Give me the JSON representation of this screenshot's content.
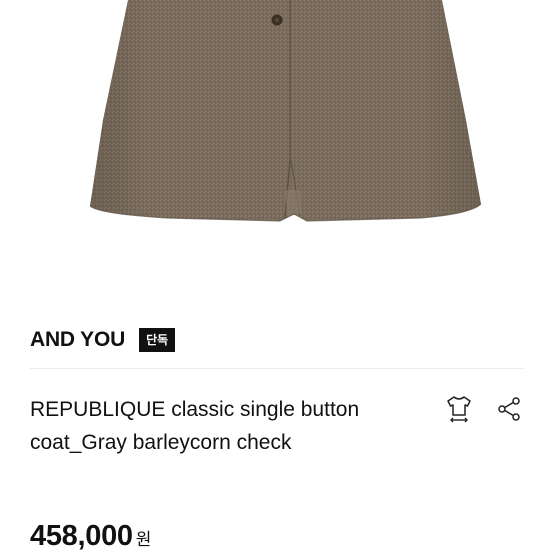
{
  "product": {
    "brand": "AND YOU",
    "badge": "단독",
    "title": "REPUBLIQUE classic single button coat_Gray barleycorn check",
    "price": "458,000",
    "currency": "원"
  },
  "icons": {
    "size_guide": "tshirt-size-icon",
    "share": "share-icon"
  },
  "colors": {
    "coat_fabric": "#7b6d5d",
    "badge_bg": "#111111",
    "text": "#111111"
  }
}
